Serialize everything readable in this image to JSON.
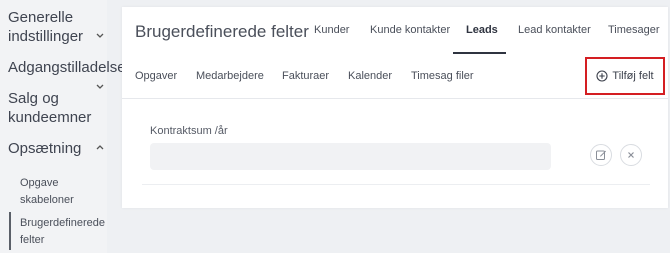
{
  "sidebar": {
    "items": [
      {
        "label_line1": "Generelle",
        "label_line2": "indstillinger",
        "chevron": "chevron-down-icon"
      },
      {
        "label_line1": "Adgangstilladelser"
      },
      {
        "label_line1": "Salg og",
        "label_line2": "kundeemner",
        "chevron": "chevron-down-icon"
      },
      {
        "label_line1": "Opsætning",
        "chevron": "chevron-up-icon"
      },
      {
        "label_line1": "Opgave",
        "label_line2": "skabeloner"
      },
      {
        "label_line1": "Brugerdefinerede",
        "label_line2": "felter",
        "active": true
      }
    ]
  },
  "header": {
    "title": "Brugerdefinerede felter",
    "tabs": [
      {
        "label": "Kunder"
      },
      {
        "label": "Kunde kontakter"
      },
      {
        "label": "Leads",
        "active": true
      },
      {
        "label": "Lead kontakter"
      },
      {
        "label": "Timesager"
      },
      {
        "label": "Opgaver"
      },
      {
        "label": "Medarbejdere"
      },
      {
        "label": "Fakturaer"
      },
      {
        "label": "Kalender"
      },
      {
        "label": "Timesag filer"
      }
    ],
    "add_button": {
      "label": "Tilføj felt",
      "icon": "plus-circle-icon",
      "highlight_color": "#d41e22"
    }
  },
  "fields": [
    {
      "label": "Kontraktsum /år",
      "value": "",
      "edit_icon": "edit-icon",
      "delete_icon": "close-icon"
    }
  ]
}
